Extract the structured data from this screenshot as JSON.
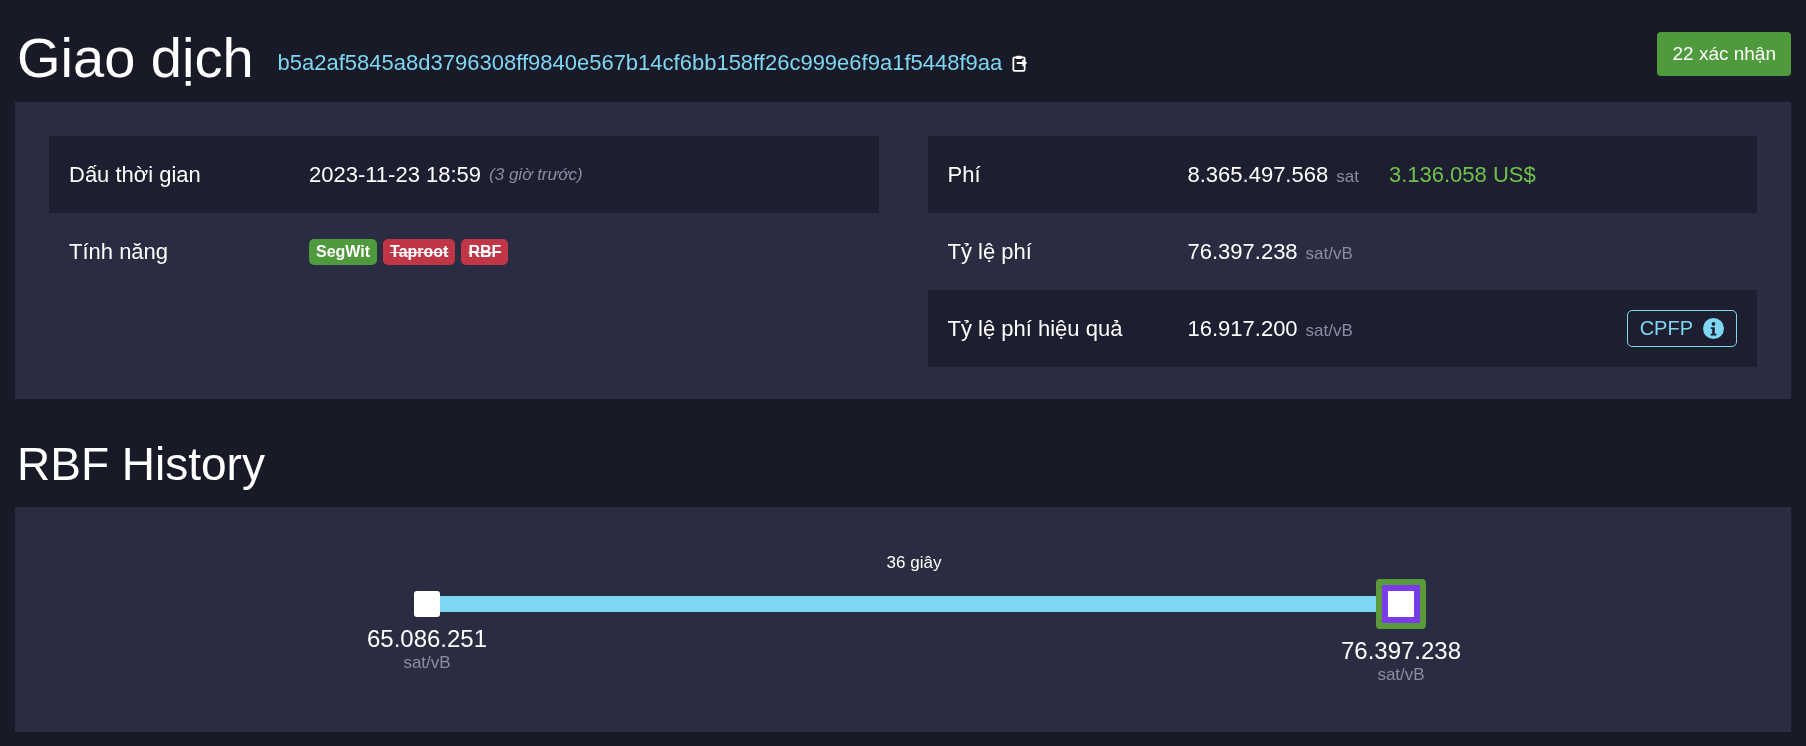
{
  "header": {
    "title": "Giao dịch",
    "txid": "b5a2af5845a8d3796308ff9840e567b14cf6bb158ff26c999e6f9a1f5448f9aa",
    "confirmations": "22 xác nhận"
  },
  "details_left": [
    {
      "label": "Dấu thời gian",
      "kind": "time",
      "value": "2023-11-23 18:59",
      "note": "(3 giờ trước)"
    },
    {
      "label": "Tính năng",
      "kind": "tags",
      "tags": [
        {
          "label": "SegWit",
          "enabled": true
        },
        {
          "label": "Taproot",
          "enabled": false
        },
        {
          "label": "RBF",
          "enabled": false
        }
      ]
    }
  ],
  "details_right": [
    {
      "label": "Phí",
      "value": "8.365.497.568",
      "unit": "sat",
      "fiat": "3.136.058 US$"
    },
    {
      "label": "Tỷ lệ phí",
      "value": "76.397.238",
      "unit": "sat/vB"
    },
    {
      "label": "Tỷ lệ phí hiệu quả",
      "value": "16.917.200",
      "unit": "sat/vB",
      "button": "CPFP"
    }
  ],
  "rbf_history": {
    "title": "RBF History",
    "nodes": [
      {
        "rate": "65.086.251",
        "unit": "sat/vB",
        "selected": false
      },
      {
        "rate": "76.397.238",
        "unit": "sat/vB",
        "selected": true
      }
    ],
    "intervals": [
      "36 giây"
    ]
  }
}
